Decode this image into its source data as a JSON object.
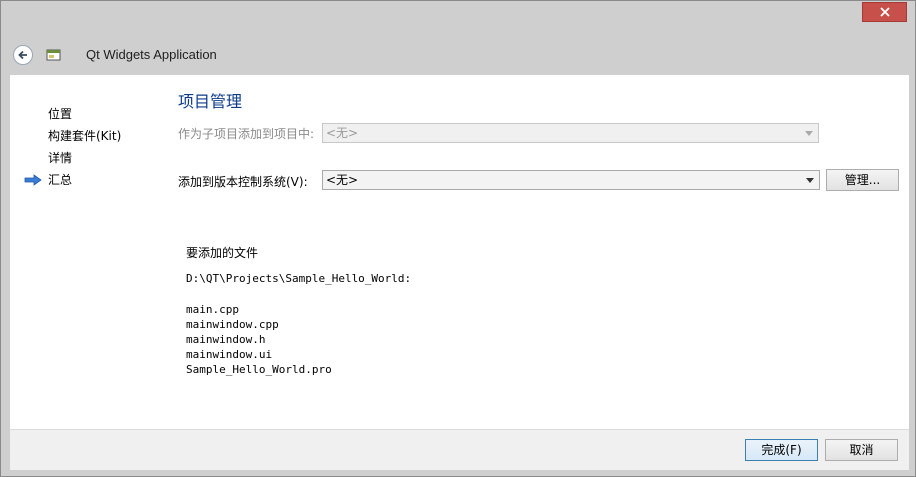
{
  "window": {
    "wizard_title": "Qt Widgets Application"
  },
  "steps": {
    "items": [
      {
        "label": "位置",
        "current": false
      },
      {
        "label": "构建套件(Kit)",
        "current": false
      },
      {
        "label": "详情",
        "current": false
      },
      {
        "label": "汇总",
        "current": true
      }
    ]
  },
  "page": {
    "heading": "项目管理",
    "add_as_subproject_label": "作为子项目添加到项目中:",
    "add_as_subproject_value": "<无>",
    "vcs_label": "添加到版本控制系统(V):",
    "vcs_value": "<无>",
    "manage_button": "管理..."
  },
  "files": {
    "title": "要添加的文件",
    "directory": "D:\\QT\\Projects\\Sample_Hello_World:",
    "list": [
      "main.cpp",
      "mainwindow.cpp",
      "mainwindow.h",
      "mainwindow.ui",
      "Sample_Hello_World.pro"
    ]
  },
  "footer": {
    "finish_button": "完成(F)",
    "cancel_button": "取消"
  },
  "colors": {
    "heading": "#0d3b8a",
    "close_button": "#c7504a",
    "step_arrow": "#3a7bd5"
  }
}
